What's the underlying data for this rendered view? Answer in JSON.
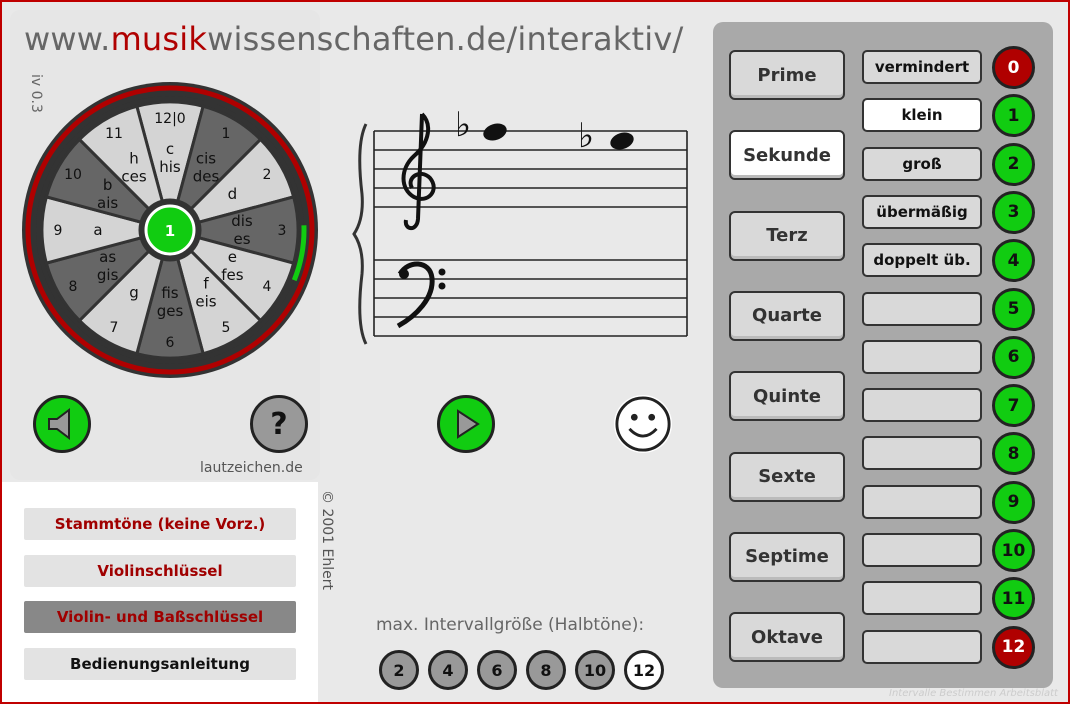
{
  "header": {
    "prefix": "www.",
    "highlight": "musik",
    "suffix": "wissenschaften.de/interaktiv/"
  },
  "version": "iv 0.3",
  "wheel": {
    "center_label": "1",
    "sectors": [
      {
        "num": "12|0",
        "names": [
          "c",
          "his"
        ],
        "shade": "light"
      },
      {
        "num": "1",
        "names": [
          "cis",
          "des"
        ],
        "shade": "dark"
      },
      {
        "num": "2",
        "names": [
          "d"
        ],
        "shade": "light"
      },
      {
        "num": "3",
        "names": [
          "dis",
          "es"
        ],
        "shade": "dark"
      },
      {
        "num": "4",
        "names": [
          "e",
          "fes"
        ],
        "shade": "light"
      },
      {
        "num": "5",
        "names": [
          "f",
          "eis"
        ],
        "shade": "light"
      },
      {
        "num": "6",
        "names": [
          "fis",
          "ges"
        ],
        "shade": "dark"
      },
      {
        "num": "7",
        "names": [
          "g"
        ],
        "shade": "light"
      },
      {
        "num": "8",
        "names": [
          "as",
          "gis"
        ],
        "shade": "dark"
      },
      {
        "num": "9",
        "names": [
          "a"
        ],
        "shade": "light"
      },
      {
        "num": "10",
        "names": [
          "b",
          "ais"
        ],
        "shade": "dark"
      },
      {
        "num": "11",
        "names": [
          "h",
          "ces"
        ],
        "shade": "light"
      }
    ],
    "colors": {
      "light": "#d4d4d4",
      "dark": "#666666",
      "ring": "#b00000",
      "center": "#11cc11"
    }
  },
  "staff": {
    "accidental": "♭"
  },
  "buttons": {
    "help": "?",
    "lautzeichen": "lautzeichen.de",
    "copyright": "© 2001 Ehlert"
  },
  "modes": [
    "Stammtöne (keine Vorz.)",
    "Violinschlüssel",
    "Violin- und Baßschlüssel",
    "Bedienungsanleitung"
  ],
  "max_interval": {
    "label": "max. Intervallgröße (Halbtöne):",
    "options": [
      "2",
      "4",
      "6",
      "8",
      "10",
      "12"
    ],
    "selected": "12"
  },
  "intervals": [
    "Prime",
    "Sekunde",
    "Terz",
    "Quarte",
    "Quinte",
    "Sexte",
    "Septime",
    "Oktave"
  ],
  "active_interval": "Sekunde",
  "qualities": [
    "vermindert",
    "klein",
    "groß",
    "übermäßig",
    "doppelt üb.",
    "",
    "",
    "",
    "",
    "",
    "",
    "",
    ""
  ],
  "active_quality": "klein",
  "semitones": [
    "0",
    "1",
    "2",
    "3",
    "4",
    "5",
    "6",
    "7",
    "8",
    "9",
    "10",
    "11",
    "12"
  ],
  "footer": "Intervalle Bestimmen Arbeitsblatt"
}
